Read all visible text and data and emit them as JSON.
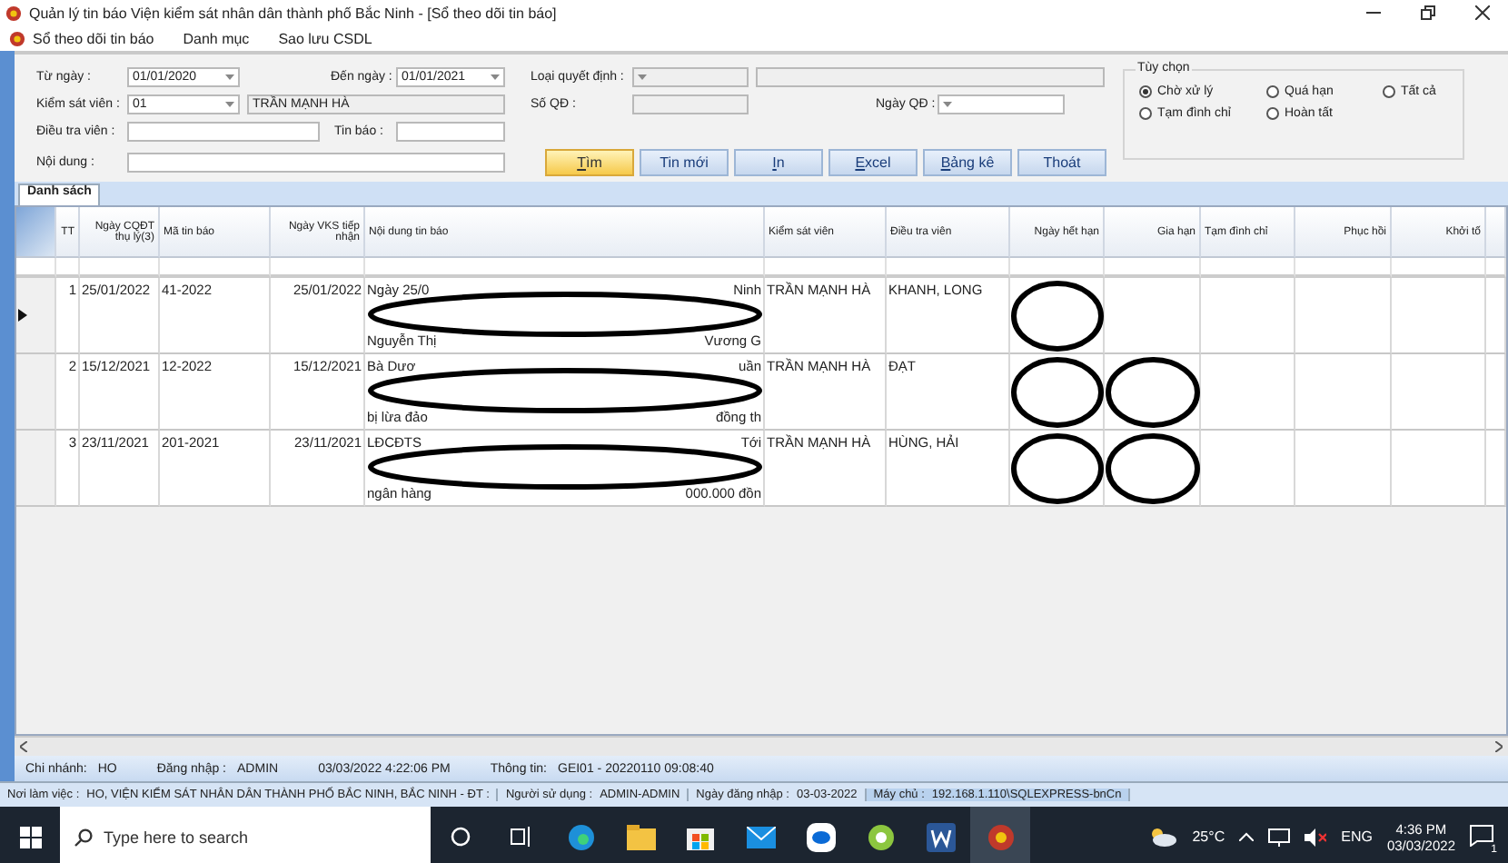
{
  "window": {
    "title": "Quản lý tin báo Viện kiểm sát nhân dân thành phố Bắc Ninh - [Sổ theo dõi tin báo]"
  },
  "menu": [
    {
      "label": "Sổ theo dõi tin báo"
    },
    {
      "label": "Danh mục"
    },
    {
      "label": "Sao lưu CSDL"
    }
  ],
  "filters": {
    "from_date": {
      "label": "Từ ngày :",
      "value": "01/01/2020"
    },
    "to_date": {
      "label": "Đến ngày :",
      "value": "01/01/2021"
    },
    "decision_type": {
      "label": "Loại quyết định :"
    },
    "prosecutor": {
      "label": "Kiểm sát viên :",
      "value": "01",
      "name": "TRẦN MẠNH HÀ"
    },
    "decision_no": {
      "label": "Số QĐ :"
    },
    "decision_date": {
      "label": "Ngày QĐ :"
    },
    "investigator": {
      "label": "Điều tra viên :"
    },
    "report": {
      "label": "Tin báo :"
    },
    "content": {
      "label": "Nội dung :"
    }
  },
  "buttons": [
    {
      "label": "Tìm",
      "highlighted": true,
      "underline_first": true
    },
    {
      "label": "Tin mới",
      "highlighted": false,
      "underline_first": false
    },
    {
      "label": "In",
      "highlighted": false,
      "underline_first": true
    },
    {
      "label": "Excel",
      "highlighted": false,
      "underline_first": true
    },
    {
      "label": "Bảng kê",
      "highlighted": false,
      "underline_first": true
    },
    {
      "label": "Thoát",
      "highlighted": false,
      "underline_first": false
    }
  ],
  "options": {
    "title": "Tùy chọn",
    "items": [
      {
        "label": "Chờ xử lý",
        "selected": true
      },
      {
        "label": "Quá hạn",
        "selected": false
      },
      {
        "label": "Tất cả",
        "selected": false
      },
      {
        "label": "Tạm đình chỉ",
        "selected": false
      },
      {
        "label": "Hoàn tất",
        "selected": false
      }
    ]
  },
  "tabs": [
    {
      "label": "Danh sách",
      "selected": true
    }
  ],
  "table": {
    "columns": [
      "TT",
      "Ngày CQĐT thụ lý(3)",
      "Mã tin báo",
      "Ngày VKS tiếp nhận",
      "Nội dung tin báo",
      "Kiểm sát viên",
      "Điều tra viên",
      "Ngày hết hạn",
      "Gia hạn",
      "Tạm đình chỉ",
      "Phục hồi",
      "Khởi tố"
    ],
    "rows": [
      {
        "selected": true,
        "tt": "1",
        "police_date": "25/01/2022",
        "code": "41-2022",
        "vks_date": "25/01/2022",
        "content": {
          "top_left": "Ngày 25/0",
          "top_right": "Ninh",
          "bottom_left": "Nguyễn Thị",
          "bottom_right": "Vương G"
        },
        "prosecutor": "TRẦN MẠNH HÀ",
        "investigator": "KHANH, LONG",
        "expiry_redacted": true,
        "extension_redacted": false
      },
      {
        "selected": false,
        "tt": "2",
        "police_date": "15/12/2021",
        "code": "12-2022",
        "vks_date": "15/12/2021",
        "content": {
          "top_left": "Bà Dươ",
          "top_right": "uần",
          "bottom_left": "bị lừa đảo",
          "bottom_right": "đồng th"
        },
        "prosecutor": "TRẦN MẠNH HÀ",
        "investigator": "ĐẠT",
        "expiry_redacted": true,
        "extension_redacted": true
      },
      {
        "selected": false,
        "tt": "3",
        "police_date": "23/11/2021",
        "code": "201-2021",
        "vks_date": "23/11/2021",
        "content": {
          "top_left": "LĐCĐTS",
          "top_right": "Tới",
          "bottom_left": "ngân hàng",
          "bottom_right": "000.000 đồn"
        },
        "prosecutor": "TRẦN MẠNH HÀ",
        "investigator": "HÙNG, HẢI",
        "expiry_redacted": true,
        "extension_redacted": true
      }
    ]
  },
  "status": [
    {
      "label": "Chi nhánh:",
      "value": "HO"
    },
    {
      "label": "Đăng nhập :",
      "value": "ADMIN"
    },
    {
      "value": "03/03/2022 4:22:06 PM"
    },
    {
      "label": "Thông tin:",
      "value": "GEI01 - 20220110 09:08:40"
    }
  ],
  "status_bar": [
    {
      "label": "Nơi làm việc :",
      "value": "HO, VIỆN KIỂM SÁT NHÂN DÂN THÀNH PHỐ BẮC NINH, BẮC NINH - ĐT :"
    },
    {
      "label": "Người sử dụng :",
      "value": "ADMIN-ADMIN"
    },
    {
      "label": "Ngày đăng nhập :",
      "value": "03-03-2022"
    },
    {
      "label": "Máy chủ :",
      "value": "192.168.1.110\\SQLEXPRESS-bnCn"
    }
  ],
  "taskbar": {
    "search": {
      "placeholder": "Type here to search"
    },
    "weather": "25°C",
    "language": "ENG",
    "time": "4:36 PM",
    "date": "03/03/2022",
    "notifications": "1"
  }
}
